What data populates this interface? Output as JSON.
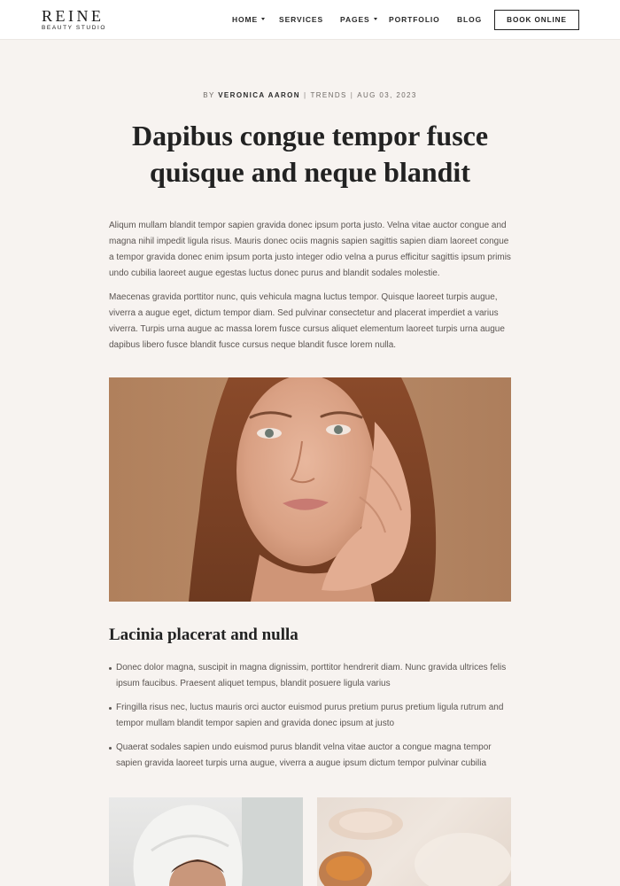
{
  "brand": {
    "name": "REINE",
    "tagline": "BEAUTY STUDIO"
  },
  "nav": {
    "items": [
      {
        "label": "HOME",
        "dropdown": true
      },
      {
        "label": "SERVICES",
        "dropdown": false
      },
      {
        "label": "PAGES",
        "dropdown": true
      },
      {
        "label": "PORTFOLIO",
        "dropdown": false
      },
      {
        "label": "BLOG",
        "dropdown": false
      }
    ],
    "cta": "BOOK ONLINE"
  },
  "post": {
    "by": "BY",
    "author": "VERONICA AARON",
    "category": "TRENDS",
    "date": "AUG 03, 2023",
    "separator": "|",
    "title": "Dapibus congue tempor fusce quisque and neque blandit",
    "paragraphs": [
      "Aliqum mullam blandit tempor sapien gravida donec ipsum porta justo. Velna vitae auctor congue and magna nihil impedit ligula risus. Mauris donec ociis magnis sapien sagittis sapien diam laoreet congue a tempor gravida donec enim ipsum porta justo integer odio velna a purus efficitur sagittis ipsum primis undo cubilia laoreet augue egestas luctus donec purus and blandit sodales molestie.",
      "Maecenas gravida porttitor nunc, quis vehicula magna luctus tempor. Quisque laoreet turpis augue, viverra a augue eget, dictum tempor diam. Sed pulvinar consectetur and placerat imperdiet a varius viverra. Turpis urna augue ac massa lorem fusce cursus aliquet elementum laoreet turpis urna augue dapibus libero fusce blandit fusce cursus neque blandit fusce lorem nulla."
    ],
    "subheading": "Lacinia placerat and nulla",
    "bullets": [
      "Donec dolor magna, suscipit in magna dignissim, porttitor hendrerit diam. Nunc gravida ultrices felis ipsum faucibus. Praesent aliquet tempus, blandit posuere ligula varius",
      "Fringilla risus nec, luctus mauris orci auctor euismod purus pretium purus pretium ligula rutrum and tempor mullam blandit tempor sapien and gravida donec ipsum at justo",
      "Quaerat sodales sapien undo euismod purus blandit velna vitae auctor a congue magna tempor sapien gravida laoreet turpis urna augue, viverra a augue ipsum dictum tempor pulvinar cubilia"
    ]
  },
  "colors": {
    "background": "#f7f3f0",
    "header": "#ffffff",
    "text": "#2b2b2b",
    "body_text": "#5b5552",
    "hero_backdrop": "#b0805c"
  }
}
